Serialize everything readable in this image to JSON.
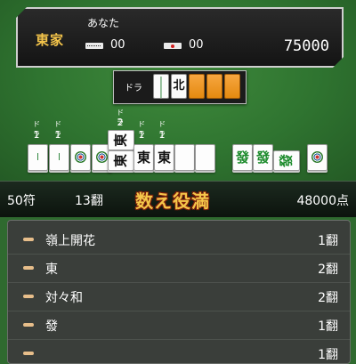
{
  "player": {
    "seat": "東家",
    "name": "あなた",
    "honba_sticks": "00",
    "riichi_sticks": "00",
    "score": "75000"
  },
  "dora_indicator": {
    "label": "ドラ",
    "revealed_tiles": [
      "3s",
      "北"
    ],
    "hidden_count": 3
  },
  "hand": {
    "tiles": [
      {
        "id": "3s-a",
        "tag": "ドラ",
        "num": "1"
      },
      {
        "id": "3s-b",
        "tag": "ドラ",
        "num": "1"
      },
      {
        "id": "3p-a"
      },
      {
        "id": "3p-b"
      },
      {
        "id": "東-a",
        "tag": "ドラ",
        "num": "2"
      },
      {
        "id": "東-b"
      },
      {
        "id": "東-c",
        "tag": "ドラ",
        "num": "1"
      },
      {
        "id": "東-d",
        "tag": "ドラ",
        "num": "1"
      },
      {
        "id": "白-a"
      },
      {
        "id": "白-b"
      },
      {
        "id": "發-a"
      },
      {
        "id": "發-b"
      },
      {
        "id": "發-c"
      },
      {
        "id": "3p-win"
      }
    ],
    "east_glyph": "東",
    "hatsu_glyph": "發",
    "north_glyph": "北"
  },
  "result": {
    "fu": "50符",
    "han": "13翻",
    "limit": "数え役満",
    "points": "48000点"
  },
  "yaku": [
    {
      "name": "嶺上開花",
      "han": "1翻"
    },
    {
      "name": "東",
      "han": "2翻"
    },
    {
      "name": "対々和",
      "han": "2翻"
    },
    {
      "name": "發",
      "han": "1翻"
    },
    {
      "name": "",
      "han": "1翻"
    }
  ],
  "colors": {
    "felt": "#2f7430",
    "seat_gold": "#f2c34a",
    "limit_gold": "#f4c64a",
    "bullet": "#e7be8a"
  }
}
